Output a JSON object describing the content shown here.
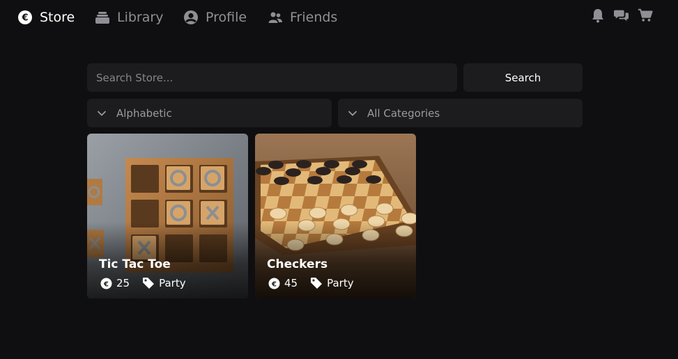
{
  "nav": {
    "items": [
      {
        "label": "Store",
        "icon": "euro-coin-icon",
        "active": true
      },
      {
        "label": "Library",
        "icon": "library-stack-icon",
        "active": false
      },
      {
        "label": "Profile",
        "icon": "user-circle-icon",
        "active": false
      },
      {
        "label": "Friends",
        "icon": "users-icon",
        "active": false
      }
    ],
    "right_icons": [
      "bell-icon",
      "chat-icon",
      "cart-icon"
    ]
  },
  "search": {
    "placeholder": "Search Store...",
    "value": "",
    "button_label": "Search"
  },
  "filters": {
    "sort": "Alphabetic",
    "category": "All Categories"
  },
  "games": [
    {
      "title": "Tic Tac Toe",
      "price": "25",
      "tag": "Party"
    },
    {
      "title": "Checkers",
      "price": "45",
      "tag": "Party"
    }
  ],
  "colors": {
    "background": "#0f0f11",
    "panel": "#1c1c1f",
    "text_primary": "#ffffff",
    "text_muted": "#8f8f95"
  }
}
